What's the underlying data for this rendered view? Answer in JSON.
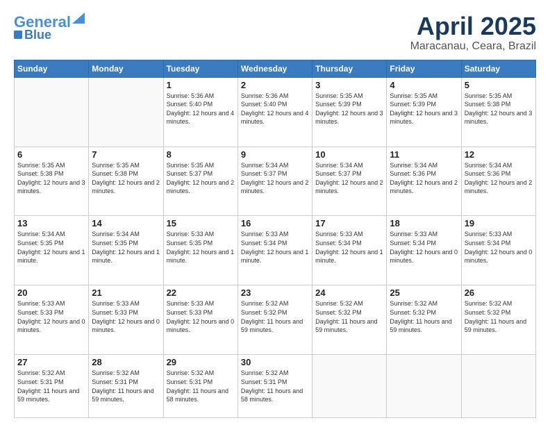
{
  "header": {
    "logo_line1": "General",
    "logo_line2": "Blue",
    "month": "April 2025",
    "location": "Maracanau, Ceara, Brazil"
  },
  "days_of_week": [
    "Sunday",
    "Monday",
    "Tuesday",
    "Wednesday",
    "Thursday",
    "Friday",
    "Saturday"
  ],
  "weeks": [
    [
      {
        "day": "",
        "info": ""
      },
      {
        "day": "",
        "info": ""
      },
      {
        "day": "1",
        "info": "Sunrise: 5:36 AM\nSunset: 5:40 PM\nDaylight: 12 hours\nand 4 minutes."
      },
      {
        "day": "2",
        "info": "Sunrise: 5:36 AM\nSunset: 5:40 PM\nDaylight: 12 hours\nand 4 minutes."
      },
      {
        "day": "3",
        "info": "Sunrise: 5:35 AM\nSunset: 5:39 PM\nDaylight: 12 hours\nand 3 minutes."
      },
      {
        "day": "4",
        "info": "Sunrise: 5:35 AM\nSunset: 5:39 PM\nDaylight: 12 hours\nand 3 minutes."
      },
      {
        "day": "5",
        "info": "Sunrise: 5:35 AM\nSunset: 5:38 PM\nDaylight: 12 hours\nand 3 minutes."
      }
    ],
    [
      {
        "day": "6",
        "info": "Sunrise: 5:35 AM\nSunset: 5:38 PM\nDaylight: 12 hours\nand 3 minutes."
      },
      {
        "day": "7",
        "info": "Sunrise: 5:35 AM\nSunset: 5:38 PM\nDaylight: 12 hours\nand 2 minutes."
      },
      {
        "day": "8",
        "info": "Sunrise: 5:35 AM\nSunset: 5:37 PM\nDaylight: 12 hours\nand 2 minutes."
      },
      {
        "day": "9",
        "info": "Sunrise: 5:34 AM\nSunset: 5:37 PM\nDaylight: 12 hours\nand 2 minutes."
      },
      {
        "day": "10",
        "info": "Sunrise: 5:34 AM\nSunset: 5:37 PM\nDaylight: 12 hours\nand 2 minutes."
      },
      {
        "day": "11",
        "info": "Sunrise: 5:34 AM\nSunset: 5:36 PM\nDaylight: 12 hours\nand 2 minutes."
      },
      {
        "day": "12",
        "info": "Sunrise: 5:34 AM\nSunset: 5:36 PM\nDaylight: 12 hours\nand 2 minutes."
      }
    ],
    [
      {
        "day": "13",
        "info": "Sunrise: 5:34 AM\nSunset: 5:35 PM\nDaylight: 12 hours\nand 1 minute."
      },
      {
        "day": "14",
        "info": "Sunrise: 5:34 AM\nSunset: 5:35 PM\nDaylight: 12 hours\nand 1 minute."
      },
      {
        "day": "15",
        "info": "Sunrise: 5:33 AM\nSunset: 5:35 PM\nDaylight: 12 hours\nand 1 minute."
      },
      {
        "day": "16",
        "info": "Sunrise: 5:33 AM\nSunset: 5:34 PM\nDaylight: 12 hours\nand 1 minute."
      },
      {
        "day": "17",
        "info": "Sunrise: 5:33 AM\nSunset: 5:34 PM\nDaylight: 12 hours\nand 1 minute."
      },
      {
        "day": "18",
        "info": "Sunrise: 5:33 AM\nSunset: 5:34 PM\nDaylight: 12 hours\nand 0 minutes."
      },
      {
        "day": "19",
        "info": "Sunrise: 5:33 AM\nSunset: 5:34 PM\nDaylight: 12 hours\nand 0 minutes."
      }
    ],
    [
      {
        "day": "20",
        "info": "Sunrise: 5:33 AM\nSunset: 5:33 PM\nDaylight: 12 hours\nand 0 minutes."
      },
      {
        "day": "21",
        "info": "Sunrise: 5:33 AM\nSunset: 5:33 PM\nDaylight: 12 hours\nand 0 minutes."
      },
      {
        "day": "22",
        "info": "Sunrise: 5:33 AM\nSunset: 5:33 PM\nDaylight: 12 hours\nand 0 minutes."
      },
      {
        "day": "23",
        "info": "Sunrise: 5:32 AM\nSunset: 5:32 PM\nDaylight: 11 hours\nand 59 minutes."
      },
      {
        "day": "24",
        "info": "Sunrise: 5:32 AM\nSunset: 5:32 PM\nDaylight: 11 hours\nand 59 minutes."
      },
      {
        "day": "25",
        "info": "Sunrise: 5:32 AM\nSunset: 5:32 PM\nDaylight: 11 hours\nand 59 minutes."
      },
      {
        "day": "26",
        "info": "Sunrise: 5:32 AM\nSunset: 5:32 PM\nDaylight: 11 hours\nand 59 minutes."
      }
    ],
    [
      {
        "day": "27",
        "info": "Sunrise: 5:32 AM\nSunset: 5:31 PM\nDaylight: 11 hours\nand 59 minutes."
      },
      {
        "day": "28",
        "info": "Sunrise: 5:32 AM\nSunset: 5:31 PM\nDaylight: 11 hours\nand 59 minutes."
      },
      {
        "day": "29",
        "info": "Sunrise: 5:32 AM\nSunset: 5:31 PM\nDaylight: 11 hours\nand 58 minutes."
      },
      {
        "day": "30",
        "info": "Sunrise: 5:32 AM\nSunset: 5:31 PM\nDaylight: 11 hours\nand 58 minutes."
      },
      {
        "day": "",
        "info": ""
      },
      {
        "day": "",
        "info": ""
      },
      {
        "day": "",
        "info": ""
      }
    ]
  ]
}
